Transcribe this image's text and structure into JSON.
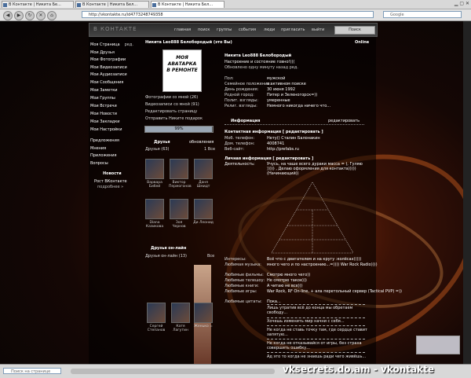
{
  "browser": {
    "tabs": [
      {
        "label": "В Контакте | Никита Бе..."
      },
      {
        "label": "В Контакте | Никита Бел..."
      },
      {
        "label": "В Контакте | Никита Бел..."
      }
    ],
    "url": "http://vkontakte.ru/id4773248749358",
    "search_placeholder": "Google",
    "find_placeholder": "Поиск на странице"
  },
  "vk": {
    "logo": "В КОНТАКТЕ",
    "top_nav": [
      "главная",
      "поиск",
      "группы",
      "события",
      "люди",
      "пригласить",
      "выйти"
    ],
    "login_btn": "Поиск"
  },
  "left_menu": {
    "items": [
      "Моя Страница",
      "Мои Друзья",
      "Мои Фотографии",
      "Мои Видеозаписи",
      "Мои Аудиозаписи",
      "Мои Сообщения",
      "Мои Заметки",
      "Мои Группы",
      "Мои Встречи",
      "Мои Новости",
      "Мои Закладки",
      "Мои Настройки"
    ],
    "edit_label": "ред.",
    "extras": [
      "Предложения",
      "Мнения",
      "Приложения",
      "Вопросы"
    ],
    "news_title": "Новости",
    "news_item": "Рост ВКонтакте",
    "news_more": "подробнее »"
  },
  "profile": {
    "name_header": "Никита Leo888 Белоборoдый (это Вы)",
    "online": "Online",
    "avatar_text": "Моя аватарка в ремонте",
    "actions": [
      "Фотографии со мной (26)",
      "Видеозаписи со мной (91)",
      "Редактировать страницу",
      "Отправить Никите подарок"
    ],
    "rating": "99%",
    "rating_fraction": 0.99,
    "friends_title": "Друзья",
    "friends_update": "обновления",
    "friends_count": "Друзья (63)",
    "friends_all": "1 Все",
    "friends": [
      "Варвара Бибей",
      "Виктор Пермогонов",
      "Даня Шмидт",
      "Diana Казикова",
      "Зоя Чернов",
      "Ди Леонид"
    ],
    "online_title": "Друзья он-лайн",
    "online_count": "Друзья он-лайн (13)",
    "online_all": "Все",
    "online_friends": [
      "Сергей Степанов",
      "Катя Лагутин",
      "Женько ="
    ]
  },
  "info": {
    "fullname": "Никита Leo888 Белоборoдый",
    "status": "Настроение и состояние говно!(((",
    "updated": "Обновлено одну минуту назад ред.",
    "rows": [
      {
        "k": "Пол:",
        "v": "мужской"
      },
      {
        "k": "Семейное положение:",
        "v": "в активном поиске"
      },
      {
        "k": "День рождения:",
        "v": "30 июня 1992"
      },
      {
        "k": "Родной город:",
        "v": "Питер и Зеленогорск=))"
      },
      {
        "k": "Полит. взгляды:",
        "v": "умеренные"
      },
      {
        "k": "Религ. взгляды:",
        "v": "Немного никогда ничего что..."
      }
    ],
    "info_header": "Информация",
    "edit_link": "редактировать",
    "contacts_header": "Контактная информация [ редактировать ]",
    "contacts": [
      {
        "k": "Моб. телефон:",
        "v": "Нету() Сталин Балонакин"
      },
      {
        "k": "Дом. телефон:",
        "v": "4008741"
      },
      {
        "k": "Веб-сайт:",
        "v": "http://prefabs.ru"
      }
    ],
    "personal_header": "Личная информация [ редактировать ]",
    "activity_k": "Деятельность:",
    "activity_v": "Учусь, на чаше всего дураки масса = ), Гуляю ))))) , Делаю оформления для контакта))))) (Начинающий))",
    "interests": [
      {
        "k": "Интересы:",
        "v": "Всё что с двигателем и на кругу :колёсах)))))"
      },
      {
        "k": "Любимая музыка:",
        "v": "много чего и по настроению...=)))) War Rock Radio))))"
      },
      {
        "k": "Любимые фильмы:",
        "v": "Смотрю много чего))"
      },
      {
        "k": "Любимые телешоу:",
        "v": "Не смотрю такое)))"
      },
      {
        "k": "Любимые книги:",
        "v": "А читаю не все)))"
      },
      {
        "k": "Любимые игры:",
        "v": "War Rock, RF On-line, + ала перетольный сервер (Tactical PVP) =))"
      },
      {
        "k": "Любимые цитаты:",
        "v": "Пока..."
      }
    ],
    "wall": [
      "Лишь утратив всё до конца мы обретаем свободу...",
      "Хочешь изменить мир начни с себя...",
      "Не когда не ставь точку там, где сердце ставит запятую...",
      "Не когда не отказывайся от игры, без страха совершить ошибку...",
      "Ад это то когда не знаешь ради чего живёшь..."
    ]
  },
  "watermark": "vksecrets.do.am - vkontakte"
}
